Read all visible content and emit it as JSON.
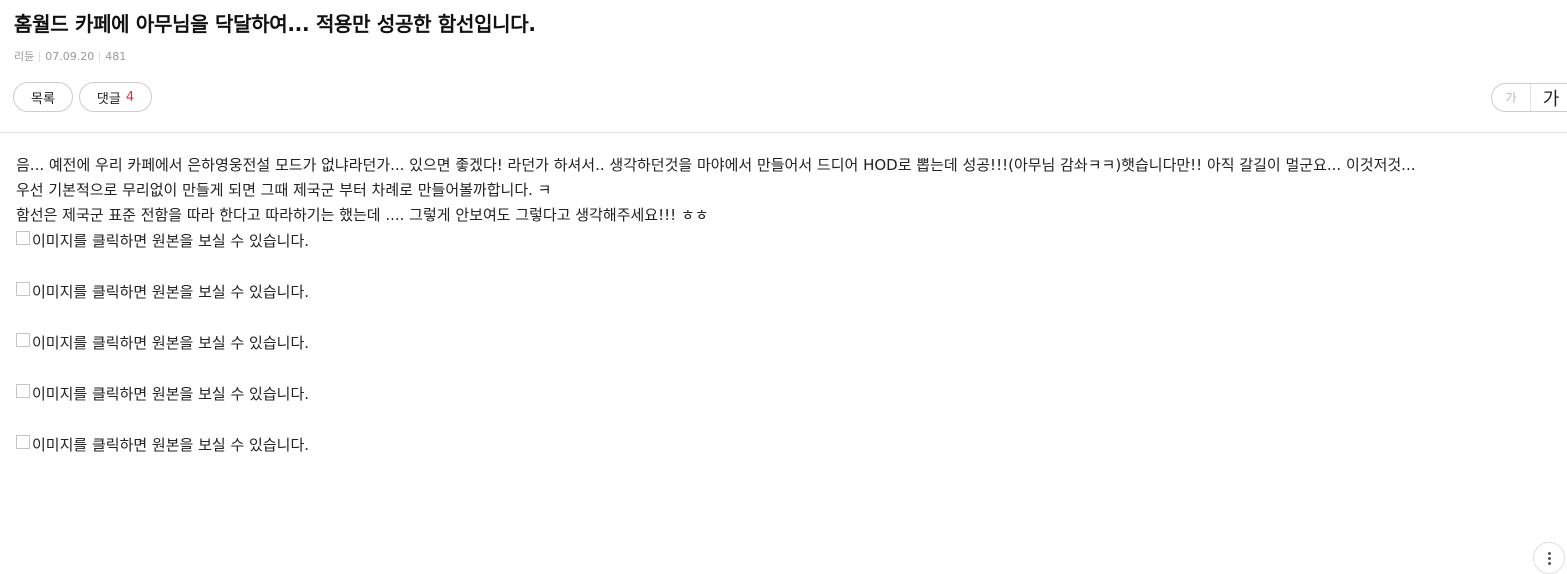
{
  "post": {
    "title": "홈월드 카페에 아무님을 닥달하여... 적용만 성공한 함선입니다.",
    "author": "리듄",
    "date": "07.09.20",
    "views": "481"
  },
  "toolbar": {
    "list_label": "목록",
    "comment_label": "댓글",
    "comment_count": "4"
  },
  "font_size_control": {
    "small_label": "가",
    "large_label": "가"
  },
  "body": {
    "paragraphs": [
      "음... 예전에 우리 카페에서 은하영웅전설 모드가 없냐라던가... 있으면 좋겠다! 라던가 하셔서.. 생각하던것을 마야에서 만들어서 드디어 HOD로 뽑는데 성공!!!(아무님 감솨ㅋㅋ)햇습니다만!! 아직 갈길이 멀군요... 이것저것...",
      "우선 기본적으로 무리없이 만들게 되면 그때 제국군 부터 차례로 만들어볼까합니다. ㅋ",
      "함선은 제국군 표준 전함을 따라 한다고 따라하기는 했는데 .... 그렇게 안보여도 그렇다고 생각해주세요!!! ㅎㅎ"
    ],
    "images": [
      {
        "caption": "이미지를 클릭하면 원본을 보실 수 있습니다."
      },
      {
        "caption": "이미지를 클릭하면 원본을 보실 수 있습니다."
      },
      {
        "caption": "이미지를 클릭하면 원본을 보실 수 있습니다."
      },
      {
        "caption": "이미지를 클릭하면 원본을 보실 수 있습니다."
      },
      {
        "caption": "이미지를 클릭하면 원본을 보실 수 있습니다."
      }
    ]
  },
  "icons": {
    "broken_image": "broken-image-icon",
    "more": "more-vertical-icon"
  }
}
